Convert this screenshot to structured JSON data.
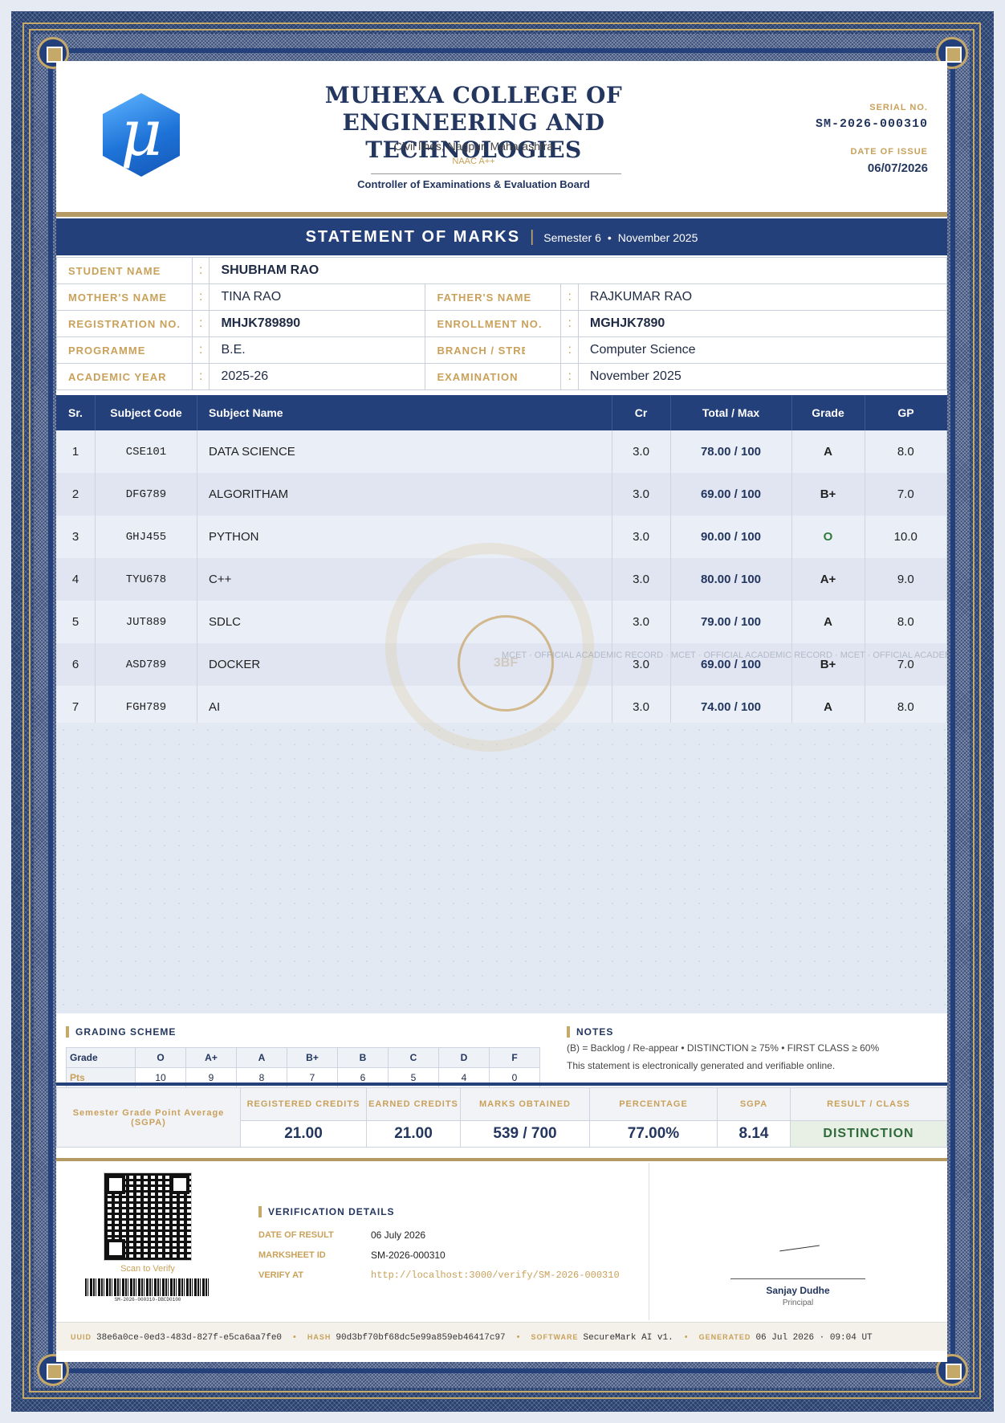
{
  "header": {
    "college_name": "MUHEXA COLLEGE OF ENGINEERING AND TECHNOLOGIES",
    "address": "Civil lines, Nagpur, Maharashtra",
    "accreditation": "NAAC A++",
    "board": "Controller of Examinations & Evaluation Board",
    "serial_label": "SERIAL NO.",
    "serial_value": "SM-2026-000310",
    "issue_label": "DATE OF ISSUE",
    "issue_value": "06/07/2026",
    "logo_glyph": "μ"
  },
  "title": {
    "main": "STATEMENT OF MARKS",
    "separator": "|",
    "semester": "Semester 6",
    "bullet": "•",
    "session": "November 2025"
  },
  "student": {
    "name_label": "STUDENT NAME",
    "name": "SHUBHAM RAO",
    "mother_label": "MOTHER'S NAME",
    "mother": "TINA RAO",
    "father_label": "FATHER'S NAME",
    "father": "RAJKUMAR RAO",
    "reg_label": "REGISTRATION NO.",
    "reg": "MHJK789890",
    "enroll_label": "ENROLLMENT NO.",
    "enroll": "MGHJK7890",
    "programme_label": "PROGRAMME",
    "programme": "B.E.",
    "branch_label": "BRANCH / STREAM",
    "branch": "Computer Science",
    "year_label": "ACADEMIC YEAR",
    "year": "2025-26",
    "exam_label": "EXAMINATION",
    "exam": "November 2025",
    "colon": ":"
  },
  "marks": {
    "headers": [
      "Sr.",
      "Subject Code",
      "Subject Name",
      "Cr",
      "Total / Max",
      "Grade",
      "GP"
    ],
    "rows": [
      {
        "sr": "1",
        "code": "CSE101",
        "name": "DATA SCIENCE",
        "cr": "3.0",
        "total": "78.00 / 100",
        "grade": "A",
        "gp": "8.0"
      },
      {
        "sr": "2",
        "code": "DFG789",
        "name": "ALGORITHAM",
        "cr": "3.0",
        "total": "69.00 / 100",
        "grade": "B+",
        "gp": "7.0"
      },
      {
        "sr": "3",
        "code": "GHJ455",
        "name": "PYTHON",
        "cr": "3.0",
        "total": "90.00 / 100",
        "grade": "O",
        "gp": "10.0"
      },
      {
        "sr": "4",
        "code": "TYU678",
        "name": "C++",
        "cr": "3.0",
        "total": "80.00 / 100",
        "grade": "A+",
        "gp": "9.0"
      },
      {
        "sr": "5",
        "code": "JUT889",
        "name": "SDLC",
        "cr": "3.0",
        "total": "79.00 / 100",
        "grade": "A",
        "gp": "8.0"
      },
      {
        "sr": "6",
        "code": "ASD789",
        "name": "DOCKER",
        "cr": "3.0",
        "total": "69.00 / 100",
        "grade": "B+",
        "gp": "7.0"
      },
      {
        "sr": "7",
        "code": "FGH789",
        "name": "AI",
        "cr": "3.0",
        "total": "74.00 / 100",
        "grade": "A",
        "gp": "8.0"
      }
    ],
    "grade_o_color": "#2f7a3a"
  },
  "watermark": {
    "text": "MCET · OFFICIAL ACADEMIC RECORD · MCET · OFFICIAL ACADEMIC RECORD · MCET · OFFICIAL ACADEMIC RECORD · MC",
    "seal_text": "3BF"
  },
  "grading": {
    "title": "GRADING SCHEME",
    "grade_label": "Grade",
    "pts_label": "Pts",
    "grades": [
      "O",
      "A+",
      "A",
      "B+",
      "B",
      "C",
      "D",
      "F"
    ],
    "points": [
      "10",
      "9",
      "8",
      "7",
      "6",
      "5",
      "4",
      "0"
    ]
  },
  "notes": {
    "title": "NOTES",
    "line1": "(B) = Backlog / Re-appear  •  DISTINCTION ≥ 75%  •  FIRST CLASS ≥ 60%",
    "line2": "This statement is electronically generated and verifiable online."
  },
  "summary": {
    "label": "Semester Grade Point Average (SGPA)",
    "reg_credits_label": "REGISTERED CREDITS",
    "reg_credits": "21.00",
    "earned_credits_label": "EARNED CREDITS",
    "earned_credits": "21.00",
    "marks_label": "MARKS OBTAINED",
    "marks": "539 / 700",
    "pct_label": "PERCENTAGE",
    "pct": "77.00%",
    "sgpa_label": "SGPA",
    "sgpa": "8.14",
    "result_label": "RESULT / CLASS",
    "result": "DISTINCTION"
  },
  "verification": {
    "scan_label": "Scan to Verify",
    "barcode_text": "SM-2026-000310-DBCD0100",
    "title": "VERIFICATION DETAILS",
    "date_label": "DATE OF RESULT",
    "date": "06 July 2026",
    "id_label": "MARKSHEET ID",
    "id": "SM-2026-000310",
    "verify_label": "VERIFY AT",
    "verify_url": "http://localhost:3000/verify/SM-2026-000310"
  },
  "signature": {
    "name": "Sanjay Dudhe",
    "role": "Principal"
  },
  "footer": {
    "uuid_label": "UUID",
    "uuid": "38e6a0ce-0ed3-483d-827f-e5ca6aa7fe0",
    "hash_label": "HASH",
    "hash": "90d3bf70bf68dc5e99a859eb46417c97",
    "software_label": "SOFTWARE",
    "software": "SecureMark AI v1.",
    "generated_label": "GENERATED",
    "generated": "06 Jul 2026 · 09:04 UT",
    "sep": "•"
  },
  "colors": {
    "navy": "#24407a",
    "gold": "#c6a968",
    "result_green": "#2f6a3a"
  }
}
